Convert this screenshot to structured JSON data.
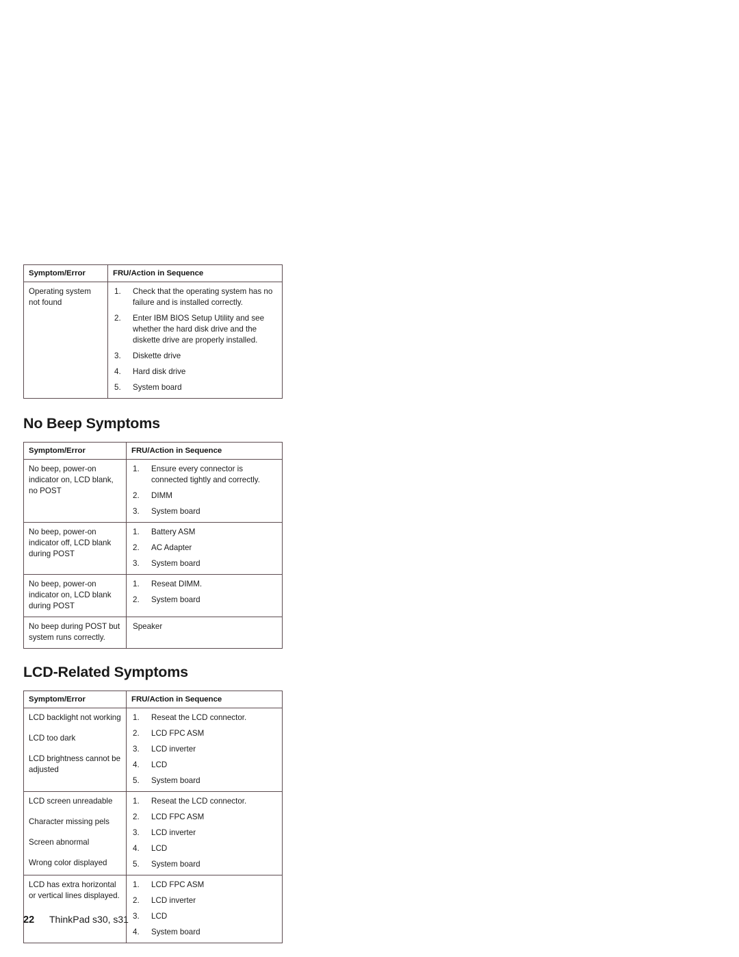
{
  "document": {
    "footer": {
      "page_number": "22",
      "book_title": "ThinkPad s30, s31"
    }
  },
  "table_headers": {
    "symptom": "Symptom/Error",
    "action": "FRU/Action in Sequence"
  },
  "sections": [
    {
      "heading": null,
      "rows": [
        {
          "symptom_lines": [
            "Operating system not found"
          ],
          "actions": [
            "Check that the operating system has no failure and is installed correctly.",
            "Enter IBM BIOS Setup Utility and see whether the hard disk drive and the diskette drive are properly installed.",
            "Diskette drive",
            "Hard disk drive",
            "System board"
          ]
        }
      ]
    },
    {
      "heading": "No Beep Symptoms",
      "rows": [
        {
          "symptom_lines": [
            "No beep, power-on indicator on, LCD blank, no POST"
          ],
          "actions": [
            "Ensure every connector is connected tightly and correctly.",
            "DIMM",
            "System board"
          ]
        },
        {
          "symptom_lines": [
            "No beep, power-on indicator off, LCD blank during POST"
          ],
          "actions": [
            "Battery ASM",
            "AC Adapter",
            "System board"
          ]
        },
        {
          "symptom_lines": [
            "No beep, power-on indicator on, LCD blank during POST"
          ],
          "actions": [
            "Reseat DIMM.",
            "System board"
          ]
        },
        {
          "symptom_lines": [
            "No beep during POST but system runs correctly."
          ],
          "plain_action": "Speaker",
          "actions": []
        }
      ]
    },
    {
      "heading": "LCD-Related Symptoms",
      "rows": [
        {
          "symptom_lines": [
            "LCD backlight not working",
            "LCD too dark",
            "LCD brightness cannot be adjusted"
          ],
          "actions": [
            "Reseat the LCD connector.",
            "LCD FPC ASM",
            "LCD inverter",
            "LCD",
            "System board"
          ]
        },
        {
          "symptom_lines": [
            "LCD screen unreadable",
            "Character missing pels",
            "Screen abnormal",
            "Wrong color displayed"
          ],
          "actions": [
            "Reseat the LCD connector.",
            "LCD FPC ASM",
            "LCD inverter",
            "LCD",
            "System board"
          ]
        },
        {
          "symptom_lines": [
            "LCD has extra horizontal or vertical lines displayed."
          ],
          "actions": [
            "LCD FPC ASM",
            "LCD inverter",
            "LCD",
            "System board"
          ]
        }
      ]
    }
  ]
}
